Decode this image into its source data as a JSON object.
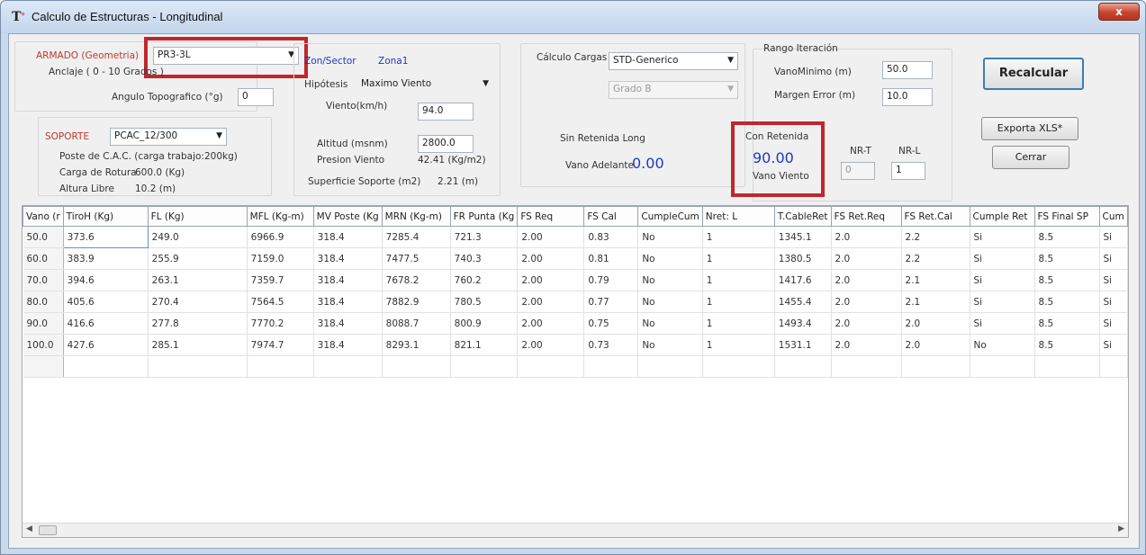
{
  "window": {
    "title": "Calculo de Estructuras - Longitudinal",
    "close_label": "x"
  },
  "armado": {
    "label": "ARMADO (Geometria)",
    "value": "PR3-3L",
    "anclaje_label": "Anclaje ( 0 - 10 Grados )",
    "angulo_label": "Angulo Topografico (°g)",
    "angulo_value": "0"
  },
  "soporte": {
    "label": "SOPORTE",
    "value": "PCAC_12/300",
    "poste_text": "Poste de C.A.C. (carga trabajo:200kg)",
    "carga_label": "Carga de Rotura",
    "carga_value": "600.0 (Kg)",
    "altura_label": "Altura Libre",
    "altura_value": "10.2 (m)"
  },
  "zona": {
    "sector_label": "Zon/Sector",
    "sector_value": "Zona1",
    "hipotesis_label": "Hipótesis",
    "hipotesis_value": "Maximo Viento",
    "viento_label": "Viento(km/h)",
    "viento_value": "94.0",
    "altitud_label": "Altitud (msnm)",
    "altitud_value": "2800.0",
    "presion_label": "Presion Viento",
    "presion_value": "42.41 (Kg/m2)",
    "superficie_label": "Superficie Soporte (m2)",
    "superficie_value": "2.21 (m)"
  },
  "calculo": {
    "label": "Cálculo Cargas",
    "value": "STD-Generico",
    "grado_value": "Grado B"
  },
  "sin_retenida": {
    "label": "Sin Retenida Long",
    "vano_label": "Vano Adelante",
    "vano_value": "0.00"
  },
  "con_retenida": {
    "label": "Con Retenida",
    "value": "90.00",
    "vano_label": "Vano Viento"
  },
  "rango": {
    "label": "Rango Iteración",
    "vano_min_label": "VanoMinimo (m)",
    "vano_min_value": "50.0",
    "margen_label": "Margen Error (m)",
    "margen_value": "10.0"
  },
  "nr": {
    "nrt_label": "NR-T",
    "nrl_label": "NR-L",
    "nrt_value": "0",
    "nrl_value": "1"
  },
  "buttons": {
    "recalcular": "Recalcular",
    "exporta": "Exporta XLS*",
    "cerrar": "Cerrar"
  },
  "grid": {
    "columns": [
      "Vano (r",
      "TiroH (Kg)",
      "FL (Kg)",
      "MFL (Kg-m)",
      "MV Poste (Kg",
      "MRN (Kg-m)",
      "FR Punta (Kg",
      "FS Req",
      "FS Cal",
      "CumpleCum",
      "Nret: L",
      "T.CableRet",
      "FS Ret.Req",
      "FS Ret.Cal",
      "Cumple Ret",
      "FS Final SP",
      "Cum"
    ],
    "rows": [
      [
        "50.0",
        "373.6",
        "249.0",
        "6966.9",
        "318.4",
        "7285.4",
        "721.3",
        "2.00",
        "0.83",
        "No",
        "1",
        "1345.1",
        "2.0",
        "2.2",
        "Si",
        "8.5",
        "Si"
      ],
      [
        "60.0",
        "383.9",
        "255.9",
        "7159.0",
        "318.4",
        "7477.5",
        "740.3",
        "2.00",
        "0.81",
        "No",
        "1",
        "1380.5",
        "2.0",
        "2.2",
        "Si",
        "8.5",
        "Si"
      ],
      [
        "70.0",
        "394.6",
        "263.1",
        "7359.7",
        "318.4",
        "7678.2",
        "760.2",
        "2.00",
        "0.79",
        "No",
        "1",
        "1417.6",
        "2.0",
        "2.1",
        "Si",
        "8.5",
        "Si"
      ],
      [
        "80.0",
        "405.6",
        "270.4",
        "7564.5",
        "318.4",
        "7882.9",
        "780.5",
        "2.00",
        "0.77",
        "No",
        "1",
        "1455.4",
        "2.0",
        "2.1",
        "Si",
        "8.5",
        "Si"
      ],
      [
        "90.0",
        "416.6",
        "277.8",
        "7770.2",
        "318.4",
        "8088.7",
        "800.9",
        "2.00",
        "0.75",
        "No",
        "1",
        "1493.4",
        "2.0",
        "2.0",
        "Si",
        "8.5",
        "Si"
      ],
      [
        "100.0",
        "427.6",
        "285.1",
        "7974.7",
        "318.4",
        "8293.1",
        "821.1",
        "2.00",
        "0.73",
        "No",
        "1",
        "1531.1",
        "2.0",
        "2.0",
        "No",
        "8.5",
        "Si"
      ]
    ]
  },
  "icons": {
    "app": "tower-icon",
    "combo_arrow": "chevron-down-icon",
    "scroll_left": "arrow-left-icon",
    "scroll_right": "arrow-right-icon"
  },
  "colors": {
    "highlight": "#c0272d",
    "blue_label": "#2035c8",
    "red_label": "#c0392b"
  }
}
